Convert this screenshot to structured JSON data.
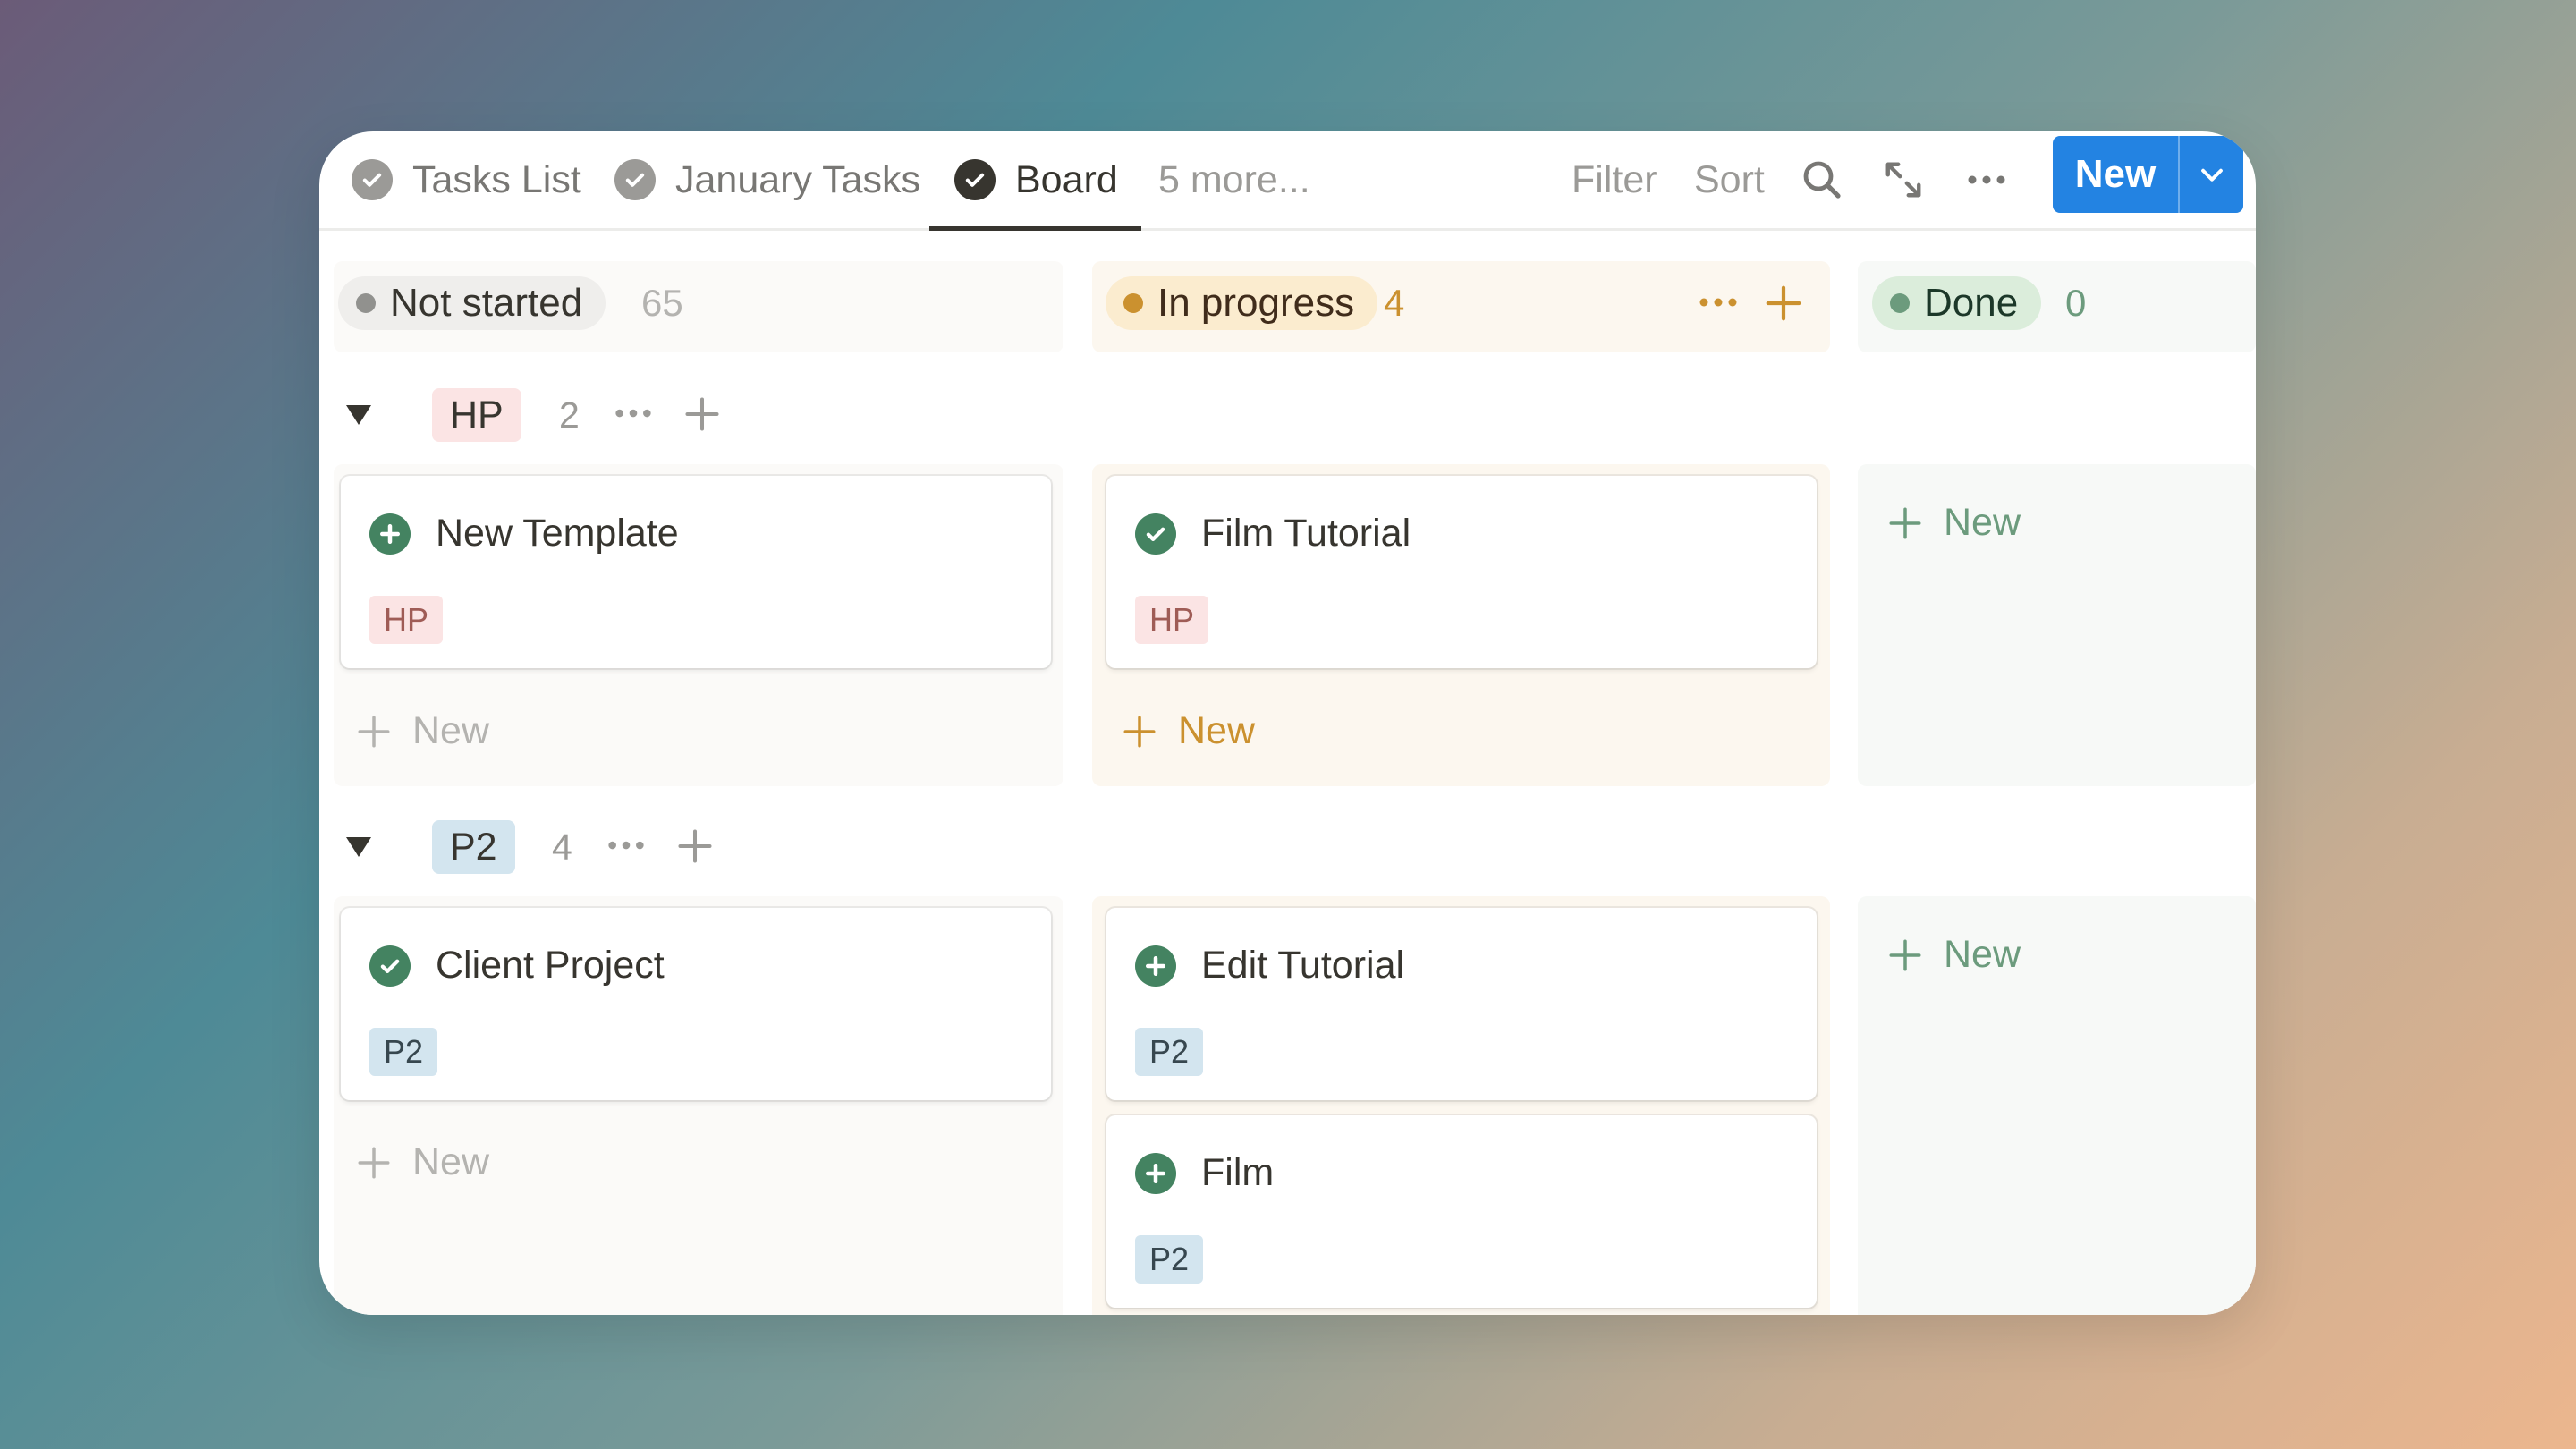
{
  "tabs": [
    {
      "label": "Tasks List"
    },
    {
      "label": "January Tasks"
    },
    {
      "label": "Board"
    }
  ],
  "more_tabs_label": "5 more...",
  "toolbar": {
    "filter_label": "Filter",
    "sort_label": "Sort",
    "new_label": "New",
    "icons": [
      "search-icon",
      "expand-icon",
      "more-icon",
      "chevron-down-icon"
    ]
  },
  "statuses": [
    {
      "label": "Not started",
      "count": "65"
    },
    {
      "label": "In progress",
      "count": "4"
    },
    {
      "label": "Done",
      "count": "0"
    }
  ],
  "groups": [
    {
      "tag": "HP",
      "count": "2",
      "cards": [
        {
          "title": "New Template",
          "tag": "HP",
          "icon": "plus-circle-icon"
        },
        {
          "title": "Film Tutorial",
          "tag": "HP",
          "icon": "check-circle-icon"
        }
      ]
    },
    {
      "tag": "P2",
      "count": "4",
      "cards": [
        {
          "title": "Client Project",
          "tag": "P2",
          "icon": "check-circle-icon"
        },
        {
          "title": "Edit Tutorial",
          "tag": "P2",
          "icon": "plus-circle-icon"
        },
        {
          "title": "Film",
          "tag": "P2",
          "icon": "plus-circle-icon"
        }
      ]
    }
  ],
  "add_new_label": "New",
  "colors": {
    "accent": "#2383e2",
    "not_started": "#91918e",
    "in_progress": "#cb912f",
    "done": "#6c9b7d",
    "icon_green": "#448361"
  }
}
